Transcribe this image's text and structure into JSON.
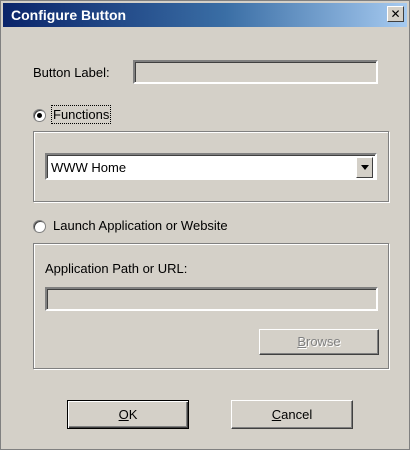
{
  "window": {
    "title": "Configure Button",
    "close_glyph": "✕"
  },
  "button_label": {
    "label": "Button Label:",
    "value": ""
  },
  "functions": {
    "radio_label": "Functions",
    "selected": true,
    "dropdown_value": "WWW Home"
  },
  "launch": {
    "radio_label": "Launch Application or Website",
    "selected": false,
    "path_label": "Application Path or URL:",
    "path_value": "",
    "browse_label_first": "B",
    "browse_label_rest": "rowse"
  },
  "footer": {
    "ok_first": "O",
    "ok_rest": "K",
    "cancel_first": "C",
    "cancel_rest": "ancel"
  }
}
